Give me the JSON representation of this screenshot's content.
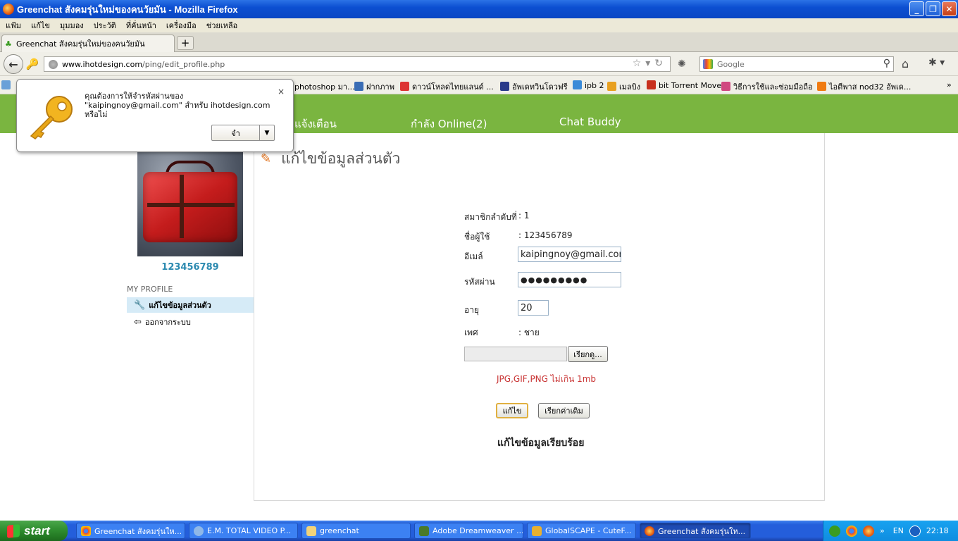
{
  "window": {
    "title": "Greenchat สังคมรุ่นใหม่ของคนวัยมัน - Mozilla Firefox"
  },
  "menu": [
    "แฟ้ม",
    "แก้ไข",
    "มุมมอง",
    "ประวัติ",
    "ที่คั่นหน้า",
    "เครื่องมือ",
    "ช่วยเหลือ"
  ],
  "tab": {
    "label": "Greenchat สังคมรุ่นใหม่ของคนวัยมัน",
    "new_tab": "+"
  },
  "address": {
    "domain": "www.ihotdesign.com",
    "path": "/ping/edit_profile.php"
  },
  "search": {
    "placeholder": "Google"
  },
  "bookmarks": [
    "photoshop มา...",
    "ฝากภาพ",
    "ดาวน์โหลดไทยแลนด์ ...",
    "อัพเดทวินโดวฟรี",
    "ipb 2",
    "เมลบิง",
    "bit Torrent Move",
    "วิธีการใช้และซ่อมมือถือ",
    "ไอดีพาส nod32 อัพเด..."
  ],
  "bookmarks_more": "»",
  "site_nav": [
    "แจ้งเตือน",
    "กำลัง Online(2)",
    "Chat Buddy"
  ],
  "sidebar": {
    "username": "123456789",
    "section": "MY PROFILE",
    "items": [
      "แก้ไขข้อมูลส่วนตัว",
      "ออกจากระบบ"
    ]
  },
  "form": {
    "title": "แก้ไขข้อมูลส่วนตัว",
    "member_label": "สมาชิกลำดับที่",
    "member_value": ": 1",
    "username_label": "ชื่อผู้ใช้",
    "username_value": ": 123456789",
    "email_label": "อีเมล์",
    "email_value": "kaipingnoy@gmail.com",
    "password_label": "รหัสผ่าน",
    "password_value": "●●●●●●●●●",
    "age_label": "อายุ",
    "age_value": "20",
    "gender_label": "เพศ",
    "gender_value": ": ชาย",
    "browse_label": "เรียกดู...",
    "hint": "JPG,GIF,PNG ไม่เกิน 1mb",
    "submit_label": "แก้ไข",
    "reset_label": "เรียกค่าเดิม",
    "success": "แก้ไขข้อมูลเรียบร้อย"
  },
  "password_popup": {
    "message": "คุณต้องการให้จำรหัสผ่านของ \"kaipingnoy@gmail.com\" สำหรับ ihotdesign.com หรือไม่",
    "choice": "จำ",
    "close": "×"
  },
  "taskbar": {
    "start": "start",
    "tasks": [
      "Greenchat สังคมรุ่นให...",
      "E.M. TOTAL VIDEO P...",
      "greenchat",
      "Adobe Dreamweaver ...",
      "GlobalSCAPE - CuteF...",
      "Greenchat สังคมรุ่นให..."
    ],
    "tray_more": "»",
    "lang": "EN",
    "time": "22:18"
  }
}
